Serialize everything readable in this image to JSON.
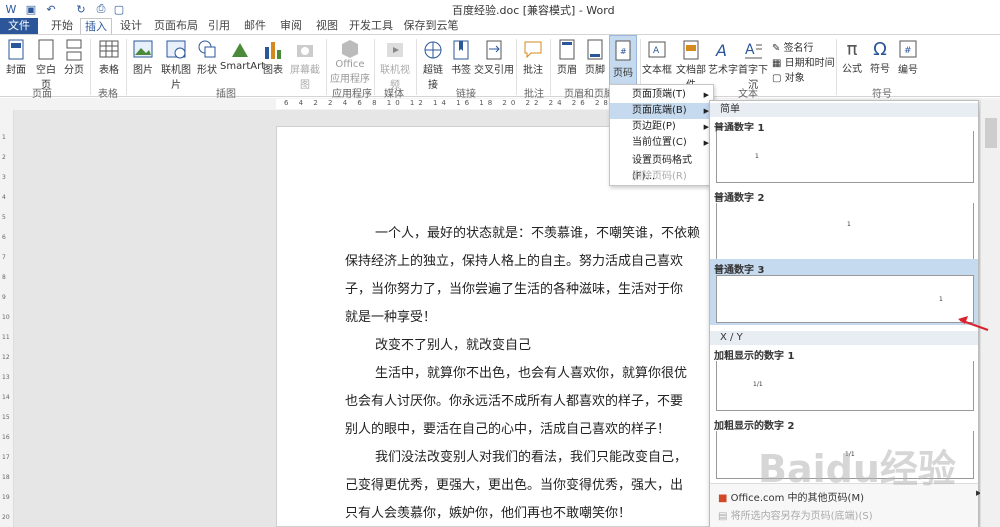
{
  "window": {
    "title": "百度经验.doc [兼容模式] - Word"
  },
  "quick_access": [
    "save-icon",
    "undo-icon",
    "redo-icon",
    "print-icon"
  ],
  "tabs": [
    "文件",
    "开始",
    "插入",
    "设计",
    "页面布局",
    "引用",
    "邮件",
    "审阅",
    "视图",
    "开发工具",
    "保存到云笔记"
  ],
  "active_tab": "插入",
  "ribbon": {
    "buttons": [
      "封面",
      "空白页",
      "分页",
      "表格",
      "图片",
      "联机图片",
      "形状",
      "SmartArt",
      "图表",
      "屏幕截图",
      "Office 应用程序",
      "联机视频",
      "超链接",
      "书签",
      "交叉引用",
      "批注",
      "页眉",
      "页脚",
      "页码",
      "文本框",
      "文档部件",
      "艺术字",
      "首字下沉",
      "公式",
      "符号",
      "编号"
    ],
    "small_buttons": [
      "签名行",
      "日期和时间",
      "对象"
    ],
    "groups": [
      "页面",
      "表格",
      "插图",
      "应用程序",
      "媒体",
      "链接",
      "批注",
      "页眉和页脚",
      "文本",
      "符号"
    ]
  },
  "ruler_numbers": "6 4 2 2 4 6 8 10 12 14 16 18 20 22 24 26 28",
  "vruler_numbers": [
    "1",
    "2",
    "3",
    "4",
    "5",
    "6",
    "7",
    "8",
    "9",
    "10",
    "11",
    "12",
    "13",
    "14",
    "15",
    "16",
    "17",
    "18",
    "19",
    "20"
  ],
  "page_number_menu": {
    "items": [
      {
        "label": "页面顶端(T)",
        "submenu": true,
        "disabled": false,
        "highlighted": false
      },
      {
        "label": "页面底端(B)",
        "submenu": true,
        "disabled": false,
        "highlighted": true
      },
      {
        "label": "页边距(P)",
        "submenu": true,
        "disabled": false,
        "highlighted": false
      },
      {
        "label": "当前位置(C)",
        "submenu": true,
        "disabled": false,
        "highlighted": false
      },
      {
        "label": "设置页码格式(F)...",
        "submenu": false,
        "disabled": false,
        "highlighted": false
      },
      {
        "label": "删除页码(R)",
        "submenu": false,
        "disabled": true,
        "highlighted": false
      }
    ]
  },
  "gallery": {
    "section1": "简单",
    "items": [
      {
        "title": "普通数字 1",
        "num": "1"
      },
      {
        "title": "普通数字 2",
        "num": "1"
      },
      {
        "title": "普通数字 3",
        "num": "1"
      }
    ],
    "section2": "X / Y",
    "items2": [
      {
        "title": "加粗显示的数字 1",
        "num": "1/1"
      },
      {
        "title": "加粗显示的数字 2",
        "num": "1/1"
      }
    ],
    "footer1": "Office.com 中的其他页码(M)",
    "footer2": "将所选内容另存为页码(底端)(S)"
  },
  "document": {
    "paragraphs": [
      "一个人，最好的状态就是：不羡慕谁，不嘲笑谁，不依赖",
      "保持经济上的独立，保持人格上的自主。努力活成自己喜欢",
      "子，当你努力了，当你尝遍了生活的各种滋味，生活对于你",
      "就是一种享受！",
      "改变不了别人，就改变自己",
      "生活中，就算你不出色，也会有人喜欢你，就算你很优",
      "也会有人讨厌你。你永远活不成所有人都喜欢的样子，不要",
      "别人的眼中，要活在自己的心中，活成自己喜欢的样子！",
      "我们没法改变别人对我们的看法，我们只能改变自己，",
      "己变得更优秀，更强大，更出色。当你变得优秀，强大，出",
      "只有人会羡慕你，嫉妒你，他们再也不敢嘲笑你！"
    ]
  },
  "watermark": "Baidu经验",
  "colors": {
    "accent": "#2b579a",
    "highlight": "#c5d9ef",
    "arrow": "#d9232e"
  }
}
